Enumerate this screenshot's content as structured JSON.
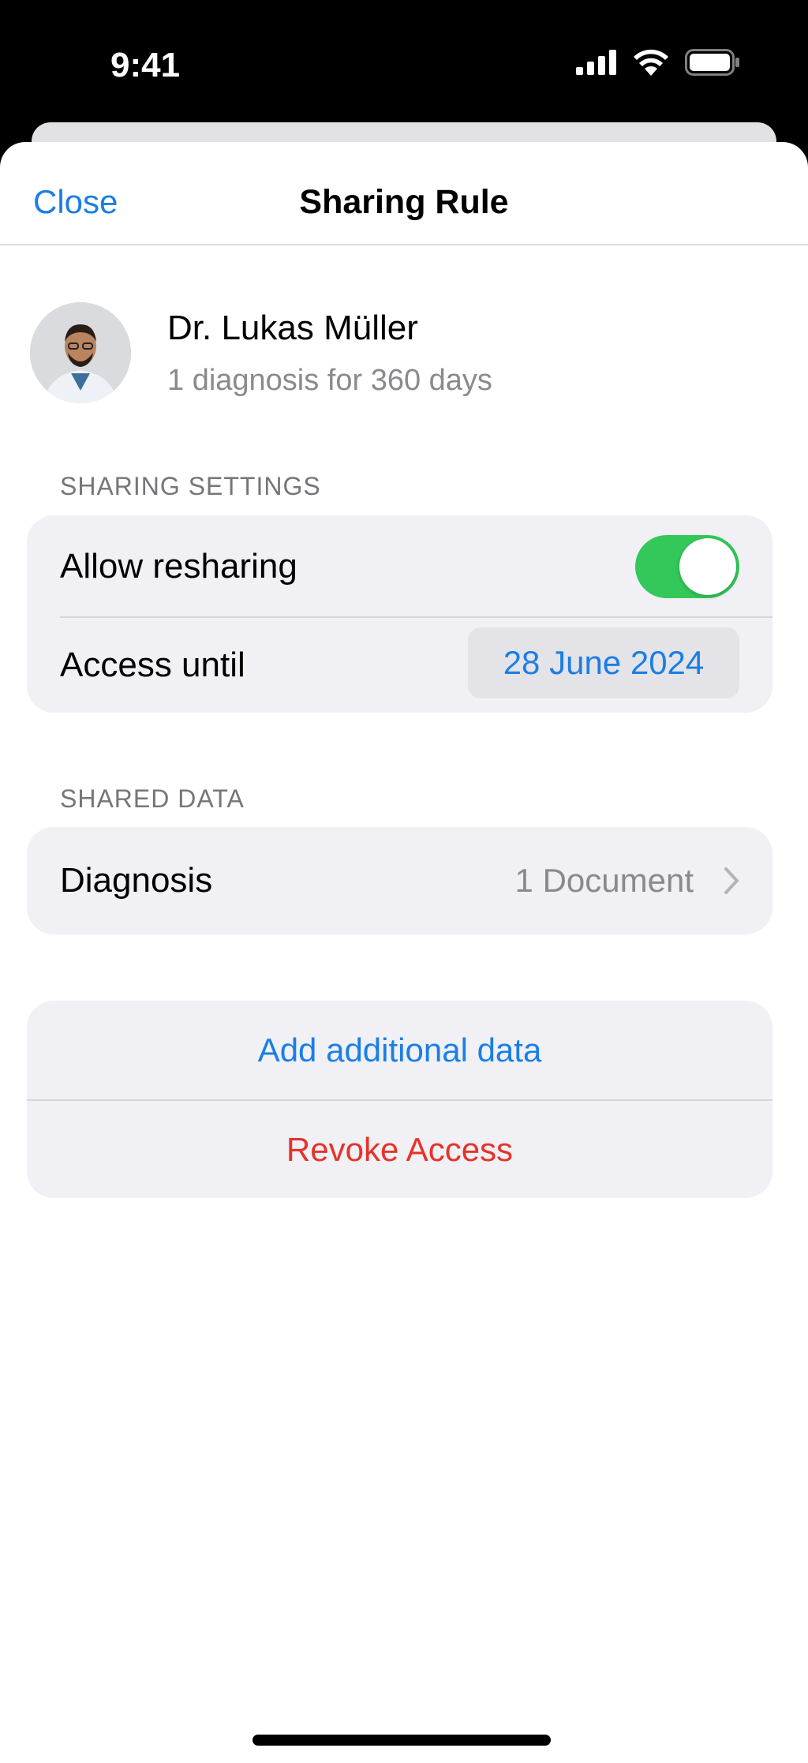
{
  "status_bar": {
    "time": "9:41"
  },
  "nav": {
    "close_label": "Close",
    "title": "Sharing Rule"
  },
  "profile": {
    "name": "Dr. Lukas Müller",
    "subtitle": "1 diagnosis for 360 days"
  },
  "sharing_settings": {
    "header": "SHARING SETTINGS",
    "allow_resharing_label": "Allow resharing",
    "allow_resharing_on": true,
    "access_until_label": "Access until",
    "access_until_value": "28 June 2024"
  },
  "shared_data": {
    "header": "SHARED DATA",
    "item_label": "Diagnosis",
    "item_count": "1 Document"
  },
  "actions": {
    "add_label": "Add additional data",
    "revoke_label": "Revoke Access"
  },
  "colors": {
    "accent": "#1a7ee6",
    "destructive": "#e5332a",
    "toggle_on": "#34c759",
    "group_bg": "#f0f0f5"
  }
}
